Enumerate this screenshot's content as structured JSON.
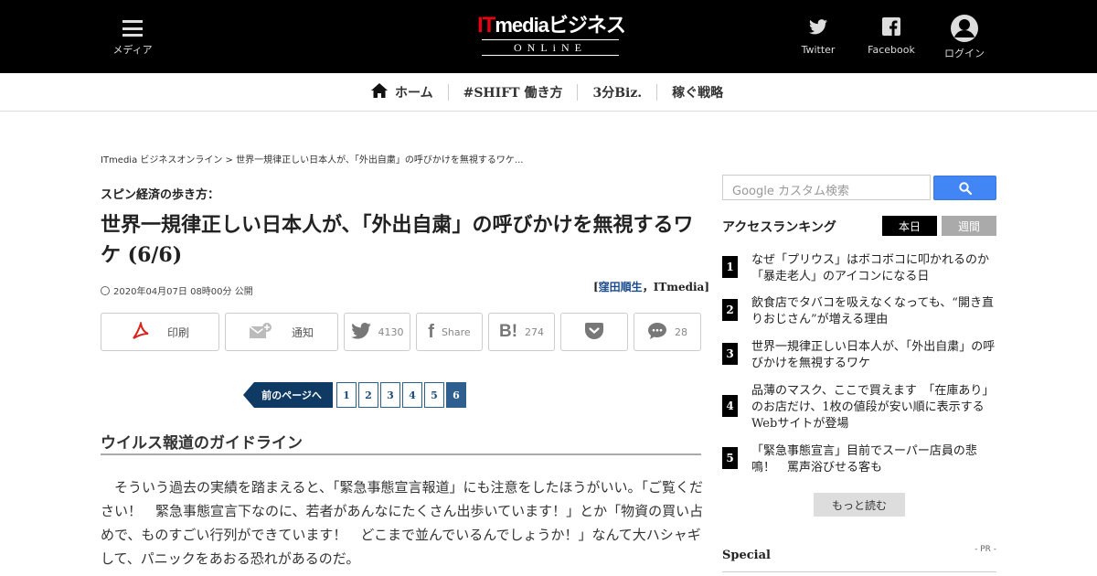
{
  "header": {
    "menu_label": "メディア",
    "logo_it": "IT",
    "logo_rest": "mediaビジネス",
    "logo_sub": "ONLiNE",
    "twitter_label": "Twitter",
    "facebook_label": "Facebook",
    "login_label": "ログイン"
  },
  "nav": {
    "items": [
      {
        "label": "ホーム",
        "icon": "home-icon"
      },
      {
        "label": "#SHIFT 働き方"
      },
      {
        "label": "3分Biz."
      },
      {
        "label": "稼ぐ戦略"
      }
    ]
  },
  "article": {
    "breadcrumb": "ITmedia ビジネスオンライン > 世界一規律正しい日本人が、「外出自粛」の呼びかけを無視するワケ...",
    "kicker": "スピン経済の歩き方：",
    "title": "世界一規律正しい日本人が、「外出自粛」の呼びかけを無視するワケ (6/6)",
    "date": "2020年04月07日 08時00分 公開",
    "author_name": "窪田順生",
    "author_org": "ITmedia",
    "share": {
      "print": "印刷",
      "notify": "通知",
      "twitter_count": "4130",
      "facebook_label": "Share",
      "hatena_count": "274",
      "comments_count": "28"
    },
    "pager": {
      "prev_label": "前のページへ",
      "pages": [
        "1",
        "2",
        "3",
        "4",
        "5",
        "6"
      ],
      "current": "6"
    },
    "section_heading": "ウイルス報道のガイドライン",
    "body": "　そういう過去の実績を踏まえると、「緊急事態宣言報道」にも注意をしたほうがいい。「ご覧ください！　緊急事態宣言下なのに、若者があんなにたくさん出歩いています！」とか「物資の買い占めで、ものすごい行列ができています！　どこまで並んでいるんでしょうか！」なんて大ハシャギして、パニックをあおる恐れがあるのだ。"
  },
  "sidebar": {
    "search_placeholder": "Google カスタム検索",
    "ranking_title": "アクセスランキング",
    "tab_today": "本日",
    "tab_week": "週間",
    "ranking": [
      {
        "num": "1",
        "text": "なぜ「プリウス」はボコボコに叩かれるのか　「暴走老人」のアイコンになる日"
      },
      {
        "num": "2",
        "text": "飲食店でタバコを吸えなくなっても、“開き直りおじさん”が増える理由"
      },
      {
        "num": "3",
        "text": "世界一規律正しい日本人が、「外出自粛」の呼びかけを無視するワケ"
      },
      {
        "num": "4",
        "text": "品薄のマスク、ここで買えます　「在庫あり」のお店だけ、1枚の値段が安い順に表示するWebサイトが登場"
      },
      {
        "num": "5",
        "text": "「緊急事態宣言」目前でスーパー店員の悲鳴！　罵声浴びせる客も"
      }
    ],
    "more_label": "もっと読む",
    "special_title": "Special",
    "special_pr": "- PR -"
  }
}
